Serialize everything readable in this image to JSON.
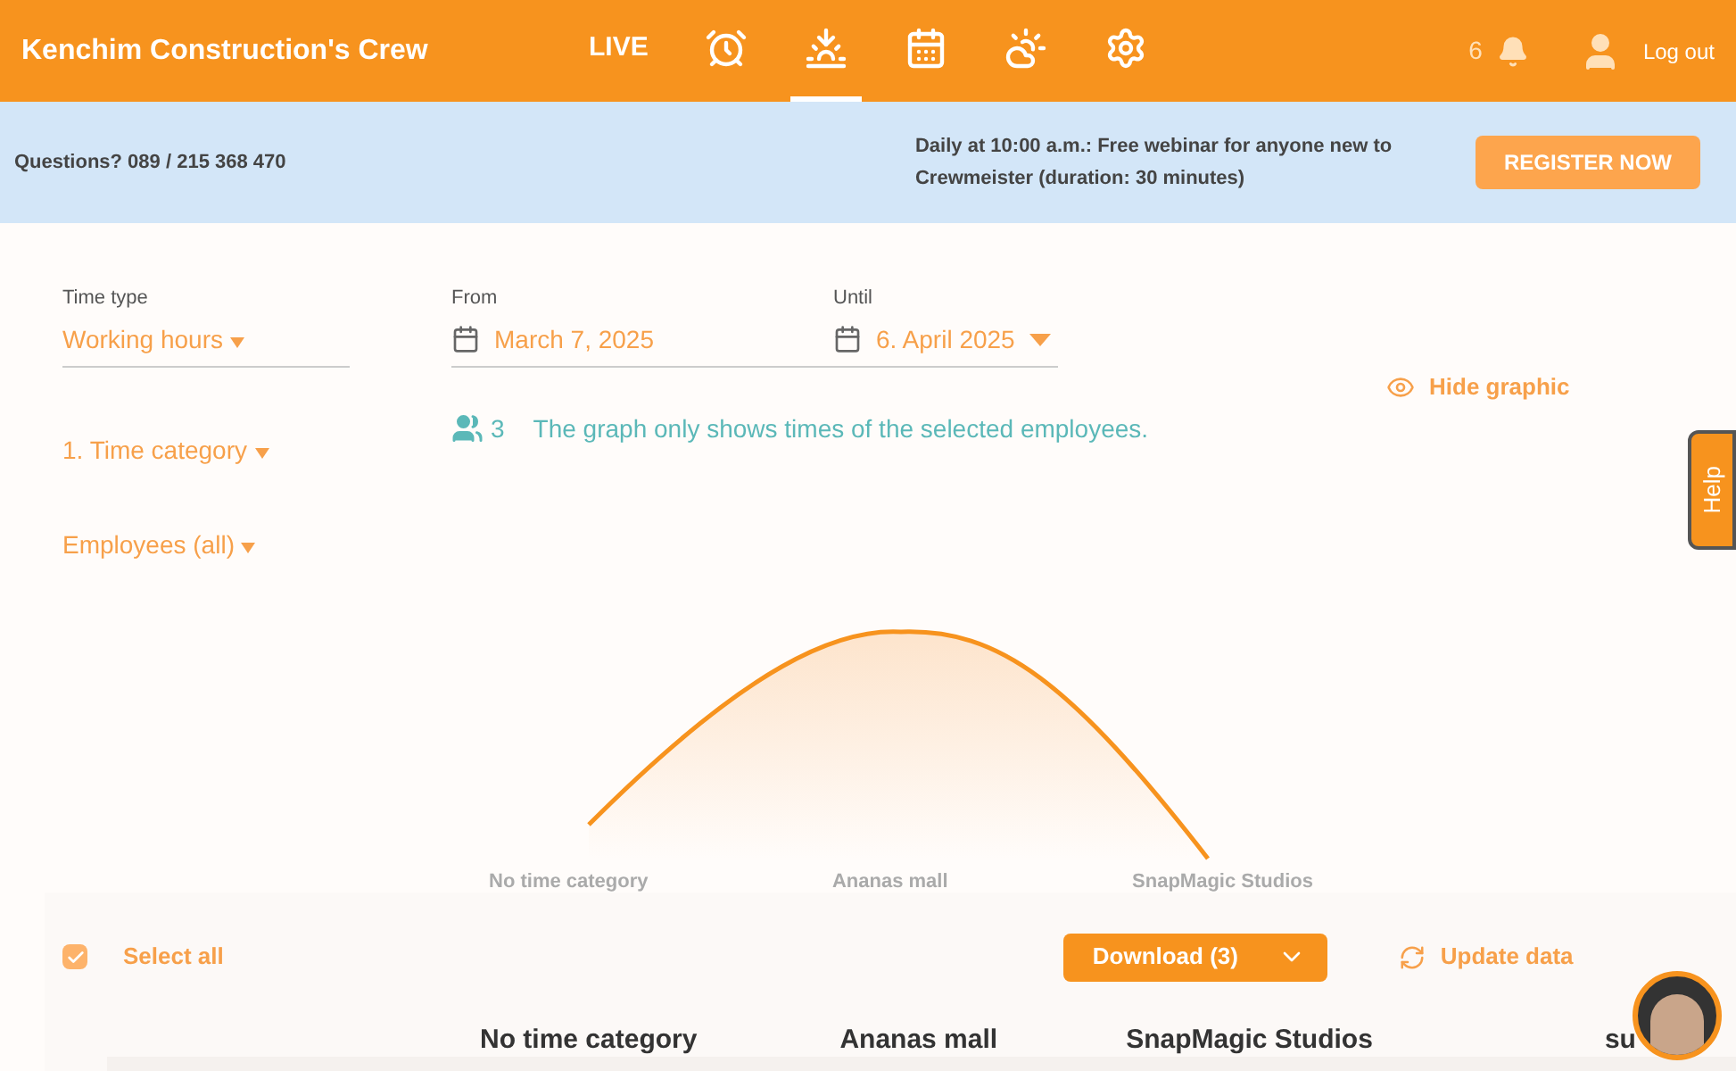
{
  "header": {
    "title": "Kenchim Construction's Crew",
    "nav": [
      {
        "kind": "text",
        "label": "LIVE",
        "selected": false
      },
      {
        "kind": "alarm",
        "selected": false
      },
      {
        "kind": "sunset",
        "selected": true
      },
      {
        "kind": "calendar",
        "selected": false
      },
      {
        "kind": "weather",
        "selected": false
      },
      {
        "kind": "settings",
        "selected": false
      }
    ],
    "notifications": "6",
    "logout": "Log out"
  },
  "banner": {
    "questions": "Questions? 089 / 215 368 470",
    "webinar": "Daily at 10:00 a.m.: Free webinar for anyone new to Crewmeister (duration: 30 minutes)",
    "button": "REGISTER NOW"
  },
  "filters": {
    "time_type": {
      "label": "Time type",
      "value": "Working hours"
    },
    "from": {
      "label": "From",
      "value": "March 7, 2025"
    },
    "until": {
      "label": "Until",
      "value": "6. April 2025"
    },
    "time_category": "1. Time category",
    "employees": "Employees (all)"
  },
  "info": {
    "count": "3",
    "message": "The graph only shows times of the selected employees."
  },
  "hide_graphic": "Hide graphic",
  "help": "Help",
  "chart": {
    "labels": [
      "No time category",
      "Ananas mall",
      "SnapMagic Studios"
    ]
  },
  "toolbar": {
    "select_all": {
      "label": "Select all",
      "checked": true
    },
    "download": "Download (3)",
    "update": "Update data"
  },
  "table": {
    "columns": [
      "No time category",
      "Ananas mall",
      "SnapMagic Studios",
      "su"
    ]
  }
}
